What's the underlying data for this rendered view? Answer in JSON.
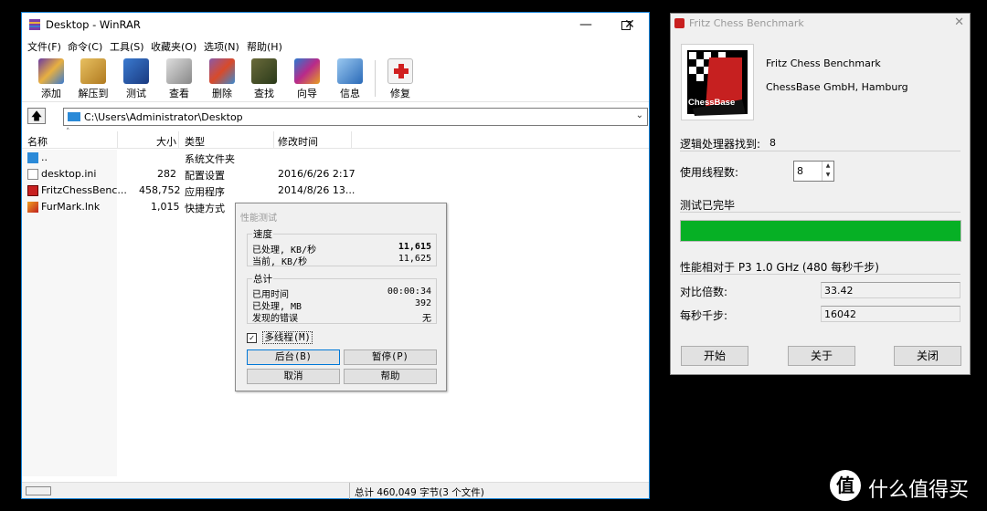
{
  "winrar": {
    "title": "Desktop - WinRAR",
    "menu": [
      "文件(F)",
      "命令(C)",
      "工具(S)",
      "收藏夹(O)",
      "选项(N)",
      "帮助(H)"
    ],
    "toolbar": [
      {
        "label": "添加",
        "icon": "add-archive-icon",
        "color": "#6a3aa2"
      },
      {
        "label": "解压到",
        "icon": "extract-to-icon",
        "color": "#c89a2a"
      },
      {
        "label": "测试",
        "icon": "test-icon",
        "color": "#2a6ab8"
      },
      {
        "label": "查看",
        "icon": "view-icon",
        "color": "#888888"
      },
      {
        "label": "删除",
        "icon": "delete-icon",
        "color": "#b84a2a"
      },
      {
        "label": "查找",
        "icon": "find-icon",
        "color": "#4a5a2a"
      },
      {
        "label": "向导",
        "icon": "wizard-icon",
        "color": "#8a2a8a"
      },
      {
        "label": "信息",
        "icon": "info-icon",
        "color": "#2a7ab8"
      },
      {
        "label": "修复",
        "icon": "repair-icon",
        "color": "#c83030"
      }
    ],
    "address": "C:\\Users\\Administrator\\Desktop",
    "columns": [
      "名称",
      "大小",
      "类型",
      "修改时间"
    ],
    "files": [
      {
        "name": "..",
        "size": "",
        "type": "系统文件夹",
        "date": ""
      },
      {
        "name": "desktop.ini",
        "size": "282",
        "type": "配置设置",
        "date": "2016/6/26 2:17"
      },
      {
        "name": "FritzChessBenc...",
        "size": "458,752",
        "type": "应用程序",
        "date": "2014/8/26 13..."
      },
      {
        "name": "FurMark.lnk",
        "size": "1,015",
        "type": "快捷方式",
        "date": ""
      }
    ],
    "status": "总计 460,049 字节(3 个文件)"
  },
  "bench": {
    "title": "性能测试",
    "speed_label": "速度",
    "processed_label": "已处理, KB/秒",
    "processed_value": "11,615",
    "current_label": "当前, KB/秒",
    "current_value": "11,625",
    "total_label": "总计",
    "elapsed_label": "已用时间",
    "elapsed_value": "00:00:34",
    "processed_mb_label": "已处理, MB",
    "processed_mb_value": "392",
    "errors_label": "发现的错误",
    "errors_value": "无",
    "multithread_label": "多线程(M)",
    "multithread_checked": true,
    "btn_background": "后台(B)",
    "btn_pause": "暂停(P)",
    "btn_cancel": "取消",
    "btn_help": "帮助"
  },
  "fritz": {
    "title": "Fritz Chess Benchmark",
    "logo_text": "ChessBase",
    "product": "Fritz Chess Benchmark",
    "company": "ChessBase GmbH, Hamburg",
    "cpu_found_label": "逻辑处理器找到:",
    "cpu_found_value": "8",
    "threads_label": "使用线程数:",
    "threads_value": "8",
    "done_label": "测试已完毕",
    "progress": 1.0,
    "progress_color": "#06b025",
    "relative_label": "性能相对于 P3 1.0 GHz (480 每秒千步)",
    "ratio_label": "对比倍数:",
    "ratio_value": "33.42",
    "kns_label": "每秒千步:",
    "kns_value": "16042",
    "btn_start": "开始",
    "btn_about": "关于",
    "btn_close": "关闭"
  },
  "watermark": {
    "icon": "值",
    "text": "什么值得买"
  }
}
